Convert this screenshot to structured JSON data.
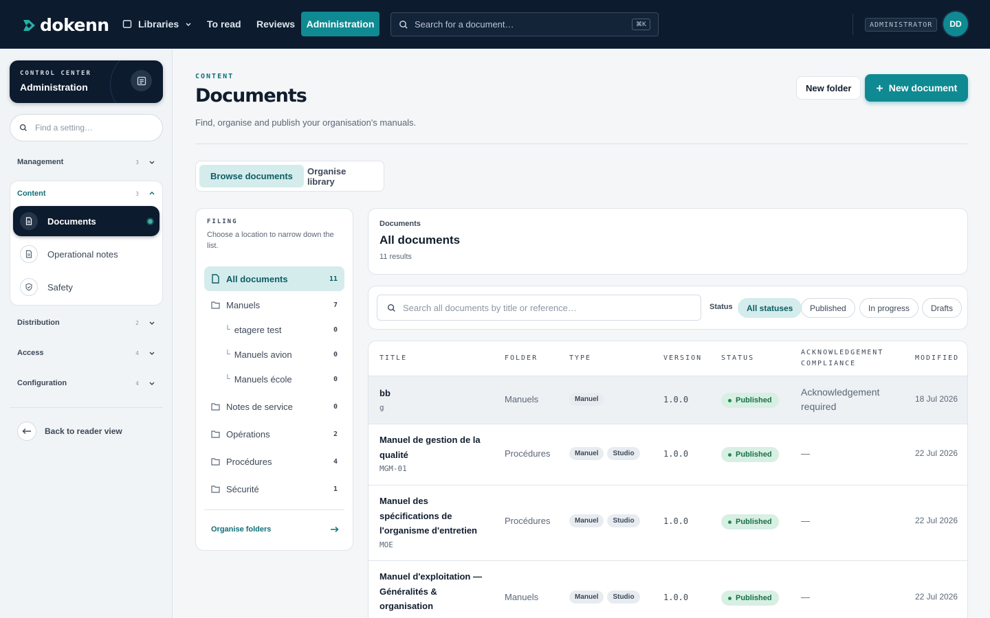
{
  "topbar": {
    "logo": "dokenn",
    "nav": {
      "libraries": "Libraries",
      "to_read": "To read",
      "reviews": "Reviews",
      "administration": "Administration"
    },
    "search_placeholder": "Search for a document…",
    "search_shortcut": "⌘K",
    "role": "ADMINISTRATOR",
    "avatar": "DD",
    "colors": {
      "bar": "#0c1b2e",
      "accent": "#0f8a92"
    }
  },
  "sidebar": {
    "eyebrow": "CONTROL CENTER",
    "title": "Administration",
    "search_placeholder": "Find a setting…",
    "groups": [
      {
        "label": "Management",
        "count": "3"
      },
      {
        "label": "Content",
        "count": "3"
      },
      {
        "label": "Distribution",
        "count": "2"
      },
      {
        "label": "Access",
        "count": "4"
      },
      {
        "label": "Configuration",
        "count": "4"
      }
    ],
    "content_items": [
      {
        "label": "Documents",
        "icon": "document-icon"
      },
      {
        "label": "Operational notes",
        "icon": "document-icon"
      },
      {
        "label": "Safety",
        "icon": "shield-icon"
      }
    ],
    "back_label": "Back to reader view"
  },
  "page": {
    "eyebrow": "CONTENT",
    "title": "Documents",
    "subtitle": "Find, organise and publish your organisation's manuals.",
    "new_folder": "New folder",
    "new_document": "New document",
    "tabs": [
      "Browse documents",
      "Organise library"
    ]
  },
  "filing": {
    "header": "FILING",
    "description": "Choose a location to narrow down the list.",
    "rows": [
      {
        "name": "All documents",
        "count": "11"
      },
      {
        "name": "Manuels",
        "count": "7"
      },
      {
        "name": "etagere test",
        "count": "0"
      },
      {
        "name": "Manuels avion",
        "count": "0"
      },
      {
        "name": "Manuels école",
        "count": "0"
      },
      {
        "name": "Notes de service",
        "count": "0"
      },
      {
        "name": "Opérations",
        "count": "2"
      },
      {
        "name": "Procédures",
        "count": "4"
      },
      {
        "name": "Sécurité",
        "count": "1"
      }
    ],
    "organise": "Organise folders"
  },
  "results": {
    "crumb": "Documents",
    "heading": "All documents",
    "count": "11 results"
  },
  "filters": {
    "search_placeholder": "Search all documents by title or reference…",
    "status_label": "Status",
    "chips": [
      "All statuses",
      "Published",
      "In progress",
      "Drafts"
    ]
  },
  "table": {
    "headers": [
      "TITLE",
      "FOLDER",
      "TYPE",
      "VERSION",
      "STATUS",
      "ACKNOWLEDGEMENT",
      "COMPLIANCE",
      "MODIFIED"
    ],
    "rows": [
      {
        "title": "bb",
        "ref": "g",
        "folder": "Manuels",
        "tags": [
          "Manuel"
        ],
        "version": "1.0.0",
        "status": "Published",
        "ack": "Acknowledgement required",
        "modified": "18 Jul 2026"
      },
      {
        "title": "Manuel de gestion de la qualité",
        "ref": "MGM-01",
        "folder": "Procédures",
        "tags": [
          "Manuel",
          "Studio"
        ],
        "version": "1.0.0",
        "status": "Published",
        "ack": "—",
        "modified": "22 Jul 2026"
      },
      {
        "title": "Manuel des spécifications de l'organisme d'entretien",
        "ref": "MOE",
        "folder": "Procédures",
        "tags": [
          "Manuel",
          "Studio"
        ],
        "version": "1.0.0",
        "status": "Published",
        "ack": "—",
        "modified": "22 Jul 2026"
      },
      {
        "title": "Manuel d'exploitation — Généralités & organisation",
        "ref": "",
        "folder": "Manuels",
        "tags": [
          "Manuel",
          "Studio"
        ],
        "version": "1.0.0",
        "status": "Published",
        "ack": "—",
        "modified": "22 Jul 2026"
      }
    ]
  }
}
